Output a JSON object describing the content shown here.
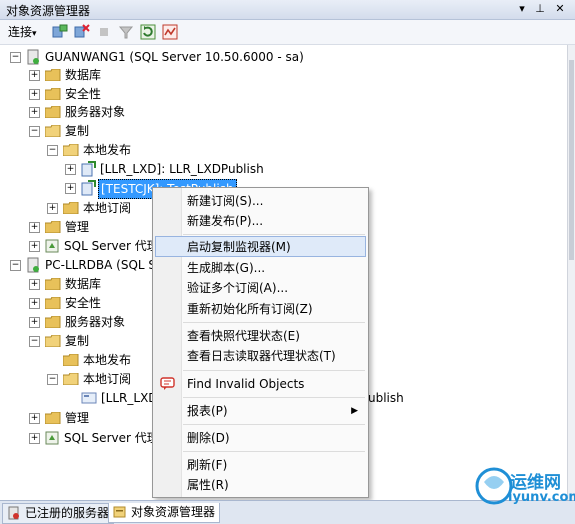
{
  "window": {
    "title": "对象资源管理器",
    "pin_glyph": "▾",
    "dock_glyph": "⊥",
    "close_glyph": "✕"
  },
  "toolbar": {
    "connect_label": "连接",
    "connect_arrow": "▾"
  },
  "tree": {
    "expand_plus": "+",
    "collapse_minus": "−",
    "server1": "GUANWANG1 (SQL Server 10.50.6000 - sa)",
    "s1_databases": "数据库",
    "s1_security": "安全性",
    "s1_server_objects": "服务器对象",
    "s1_replication": "复制",
    "s1_local_publications": "本地发布",
    "s1_pub1": "[LLR_LXD]: LLR_LXDPublish",
    "s1_pub2_selected": "[TESTCJK]: TestPublish",
    "s1_local_subscriptions": "本地订阅",
    "s1_management": "管理",
    "s1_agent": "SQL Server 代理",
    "server2": "PC-LLRDBA (SQL Se",
    "s2_databases": "数据库",
    "s2_security": "安全性",
    "s2_server_objects": "服务器对象",
    "s2_replication": "复制",
    "s2_local_publications": "本地发布",
    "s2_local_subscriptions": "本地订阅",
    "s2_sub1_left": "[LLR_LXD]",
    "s2_sub1_right": "ublish",
    "s2_management": "管理",
    "s2_agent": "SQL Server 代理"
  },
  "context_menu": {
    "items": [
      {
        "label": "新建订阅(S)..."
      },
      {
        "label": "新建发布(P)..."
      },
      {
        "label": "启动复制监视器(M)"
      },
      {
        "label": "生成脚本(G)..."
      },
      {
        "label": "验证多个订阅(A)..."
      },
      {
        "label": "重新初始化所有订阅(Z)"
      },
      {
        "label": "查看快照代理状态(E)"
      },
      {
        "label": "查看日志读取器代理状态(T)"
      },
      {
        "label": "Find Invalid Objects"
      },
      {
        "label": "报表(P)"
      },
      {
        "label": "删除(D)"
      },
      {
        "label": "刷新(F)"
      },
      {
        "label": "属性(R)"
      }
    ],
    "submenu_arrow": "▶",
    "highlighted_index": 2
  },
  "bottom_tabs": {
    "registered_servers": "已注册的服务器",
    "object_explorer": "对象资源管理器"
  },
  "watermark": {
    "text_cn": "运维网",
    "text_en": "iyunv.com"
  },
  "colors": {
    "selection": "#3399ff",
    "menu_highlight": "#dfeaf9",
    "folder": "#e8c15a"
  }
}
